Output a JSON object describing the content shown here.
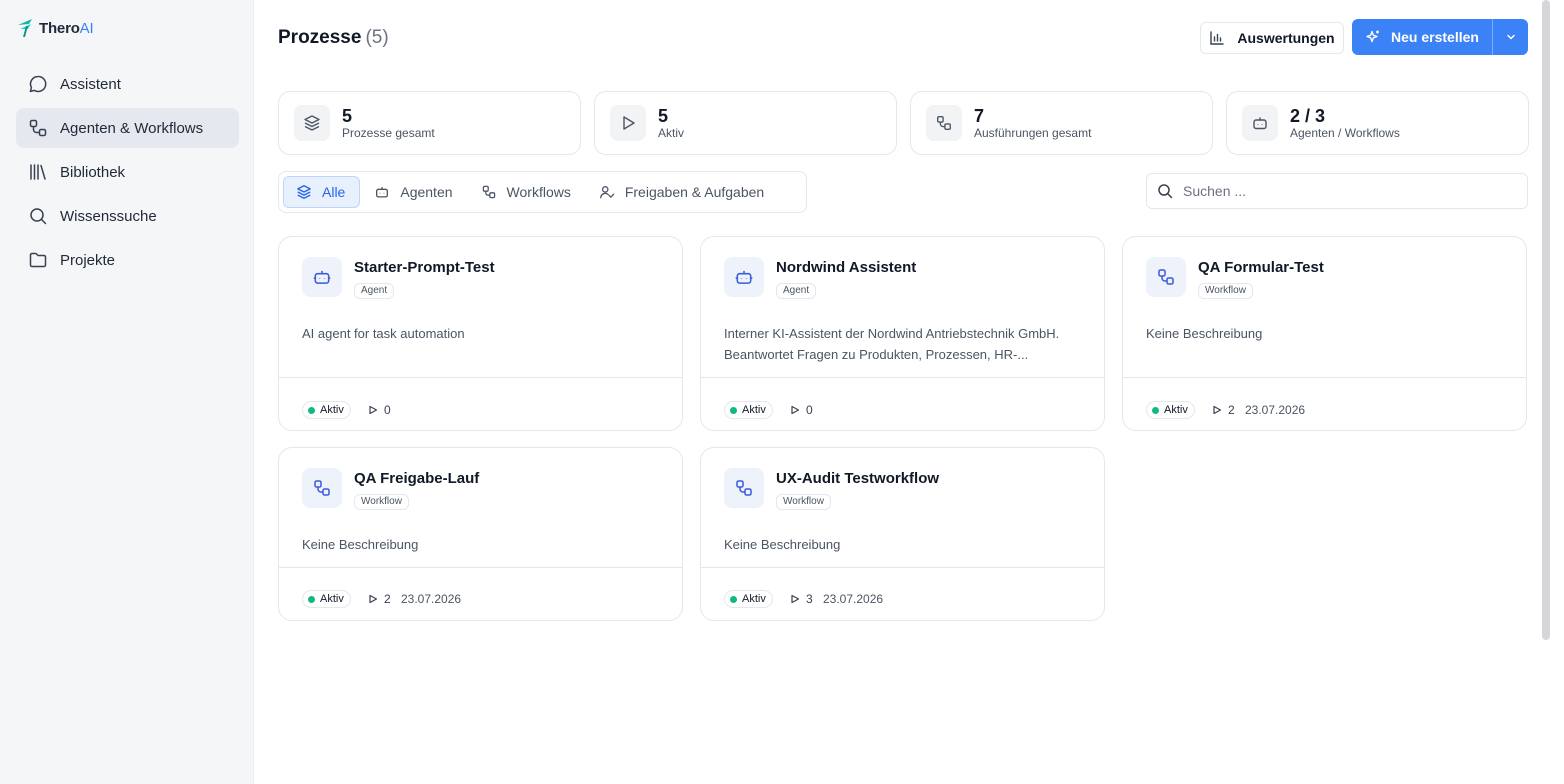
{
  "app": {
    "logo_main": "Thero",
    "logo_accent": "AI"
  },
  "sidebar": {
    "items": [
      {
        "label": "Assistent",
        "icon": "chat-bubble-icon",
        "active": false
      },
      {
        "label": "Agenten & Workflows",
        "icon": "workflow-icon",
        "active": true
      },
      {
        "label": "Bibliothek",
        "icon": "library-icon",
        "active": false
      },
      {
        "label": "Wissenssuche",
        "icon": "search-icon",
        "active": false
      },
      {
        "label": "Projekte",
        "icon": "folder-icon",
        "active": false
      }
    ]
  },
  "header": {
    "title": "Prozesse",
    "count": "(5)",
    "reports_label": "Auswertungen",
    "create_label": "Neu erstellen"
  },
  "stats": [
    {
      "value": "5",
      "label": "Prozesse gesamt",
      "icon": "layers-icon"
    },
    {
      "value": "5",
      "label": "Aktiv",
      "icon": "play-icon"
    },
    {
      "value": "7",
      "label": "Ausführungen gesamt",
      "icon": "workflow-icon"
    },
    {
      "value": "2 / 3",
      "label": "Agenten / Workflows",
      "icon": "robot-icon"
    }
  ],
  "filters": [
    {
      "label": "Alle",
      "icon": "layers-icon",
      "active": true
    },
    {
      "label": "Agenten",
      "icon": "robot-icon",
      "active": false
    },
    {
      "label": "Workflows",
      "icon": "workflow-icon",
      "active": false
    },
    {
      "label": "Freigaben & Aufgaben",
      "icon": "user-check-icon",
      "active": false
    }
  ],
  "search": {
    "placeholder": "Suchen ..."
  },
  "cards": [
    {
      "title": "Starter-Prompt-Test",
      "type": "Agent",
      "icon": "robot-icon",
      "description": "AI agent for task automation",
      "status": "Aktiv",
      "runs": "0",
      "date": ""
    },
    {
      "title": "Nordwind Assistent",
      "type": "Agent",
      "icon": "robot-icon",
      "description": "Interner KI-Assistent der Nordwind Antriebstechnik GmbH. Beantwortet Fragen zu Produkten, Prozessen, HR-...",
      "status": "Aktiv",
      "runs": "0",
      "date": ""
    },
    {
      "title": "QA Formular-Test",
      "type": "Workflow",
      "icon": "workflow-icon",
      "description": "Keine Beschreibung",
      "status": "Aktiv",
      "runs": "2",
      "date": "23.07.2026"
    },
    {
      "title": "QA Freigabe-Lauf",
      "type": "Workflow",
      "icon": "workflow-icon",
      "description": "Keine Beschreibung",
      "status": "Aktiv",
      "runs": "2",
      "date": "23.07.2026"
    },
    {
      "title": "UX-Audit Testworkflow",
      "type": "Workflow",
      "icon": "workflow-icon",
      "description": "Keine Beschreibung",
      "status": "Aktiv",
      "runs": "3",
      "date": "23.07.2026"
    }
  ],
  "colors": {
    "accent": "#3b82f6",
    "status_active": "#10b981",
    "sidebar_bg": "#f5f6f8"
  }
}
